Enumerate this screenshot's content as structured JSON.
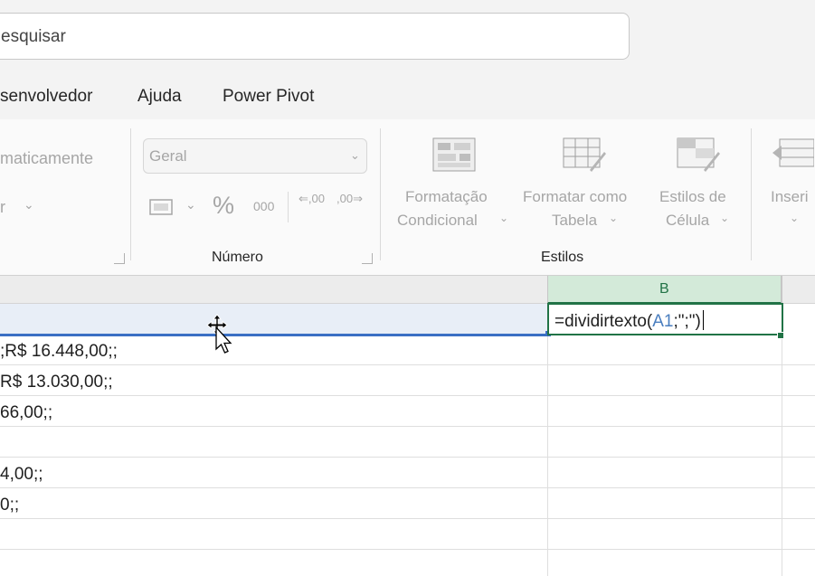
{
  "search": {
    "value": "esquisar"
  },
  "tabs": [
    "senvolvedor",
    "Ajuda",
    "Power Pivot"
  ],
  "ribbon": {
    "left_fragment_1": "maticamente",
    "left_fragment_2": "r",
    "number_format": "Geral",
    "percent_label": "%",
    "thousands_label": "000",
    "inc_decimal_label": ",00",
    "dec_decimal_label": ",00",
    "group_numero": "Número",
    "cond_format_line1": "Formatação",
    "cond_format_line2": "Condicional",
    "format_table_line1": "Formatar como",
    "format_table_line2": "Tabela",
    "cell_styles_line1": "Estilos de",
    "cell_styles_line2": "Célula",
    "group_estilos": "Estilos",
    "insert_label": "Inseri"
  },
  "grid": {
    "column_b": "B",
    "cells": [
      ";R$ 16.448,00;;",
      "R$ 13.030,00;;",
      "66,00;;",
      "",
      "4,00;;",
      "0;;"
    ],
    "formula_prefix": "=dividirtexto(",
    "formula_ref": "A1",
    "formula_suffix": ";\";\")"
  },
  "colors": {
    "excel_green": "#217346",
    "selection_blue": "#3a6fc4"
  }
}
